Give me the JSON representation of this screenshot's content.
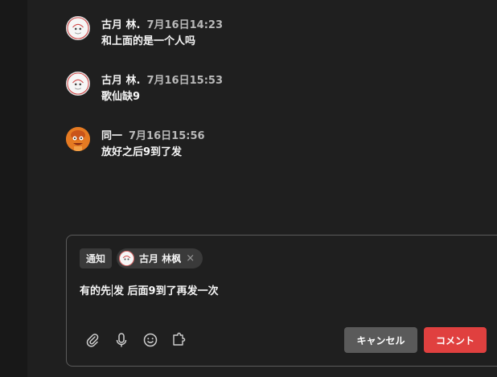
{
  "messages": [
    {
      "author": "古月 林.",
      "time": "7月16日14:23",
      "text": "和上面的是一个人吗",
      "avatar": "white-doodle-avatar"
    },
    {
      "author": "古月 林.",
      "time": "7月16日15:53",
      "text": "歌仙缺9",
      "avatar": "white-doodle-avatar"
    },
    {
      "author": "同一",
      "time": "7月16日15:56",
      "text": "放好之后9到了发",
      "avatar": "orange-character-avatar"
    }
  ],
  "composer": {
    "notify_label": "通知",
    "mention_name": "古月 林枫",
    "mention_close": "×",
    "text_before_caret": "有的先",
    "text_after_caret": "发 后面9到了再发一次",
    "cancel_label": "キャンセル",
    "comment_label": "コメント",
    "tools": [
      "paperclip-icon",
      "microphone-icon",
      "emoji-icon",
      "extension-icon"
    ]
  },
  "colors": {
    "background": "#1f1f1f",
    "accent": "#e0403f",
    "secondary_button": "#5a5a5a"
  }
}
